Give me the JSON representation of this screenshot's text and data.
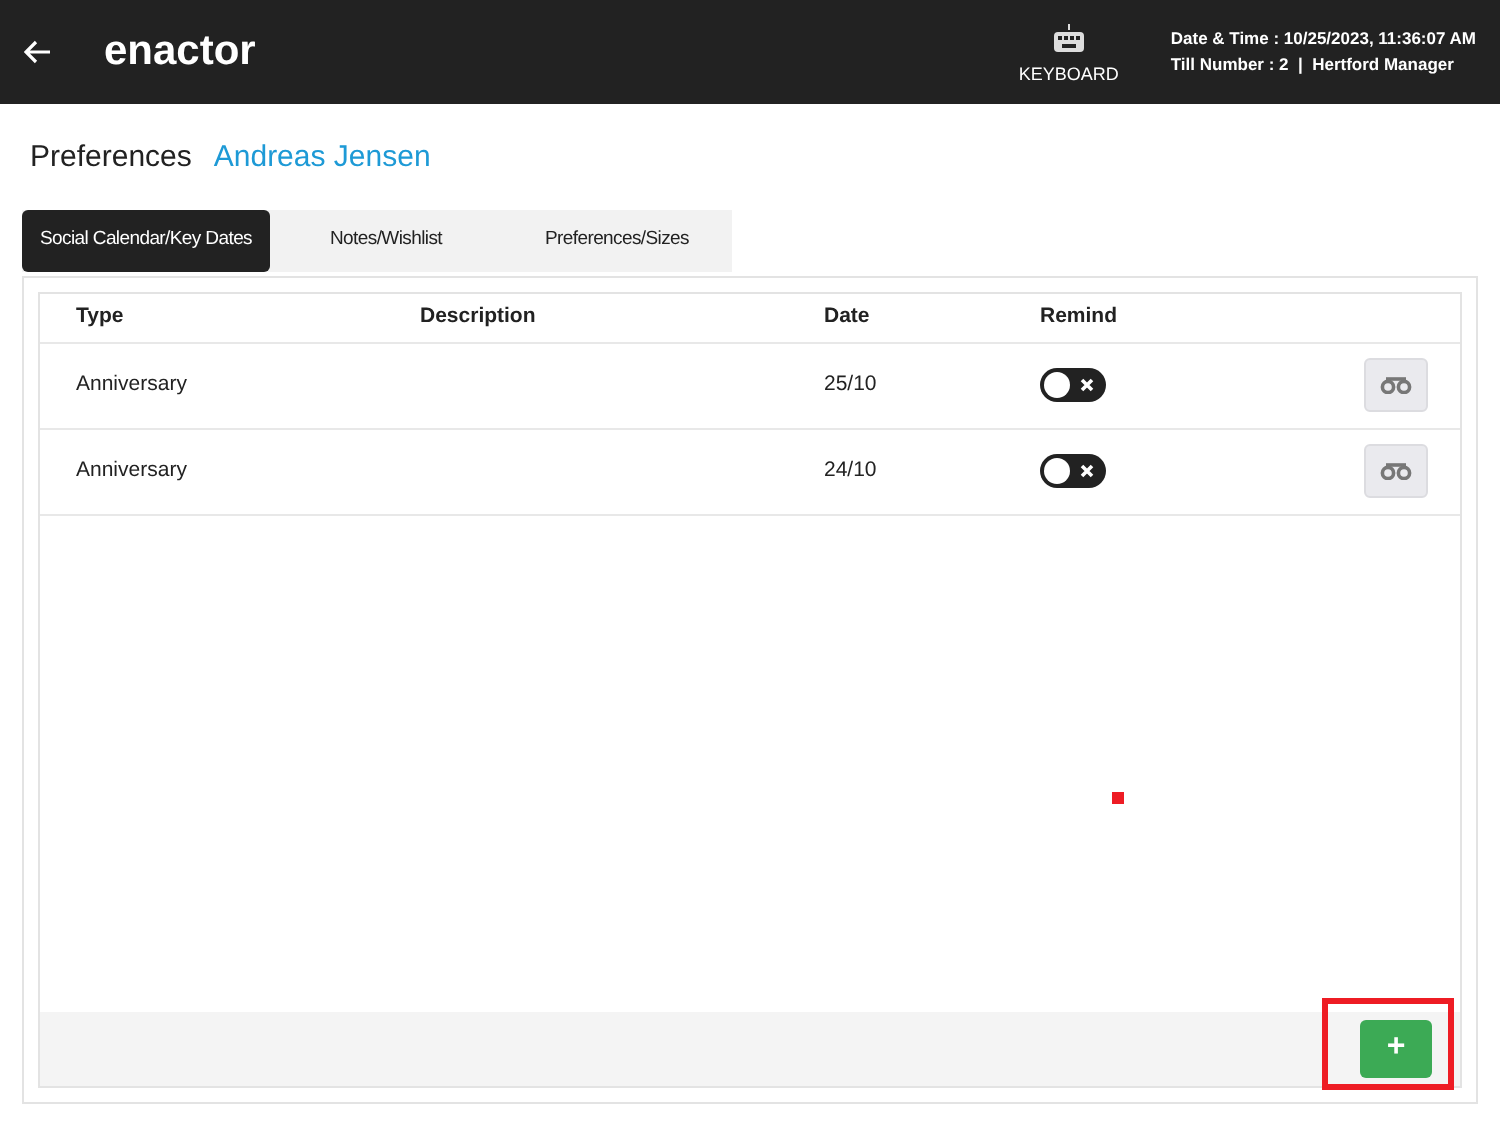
{
  "header": {
    "logo": "enactor",
    "keyboard_label": "KEYBOARD",
    "datetime": "Date & Time : 10/25/2023, 11:36:07 AM",
    "till": "Till Number : 2  |  Hertford Manager"
  },
  "title": {
    "label": "Preferences",
    "customer": "Andreas Jensen"
  },
  "tabs": [
    {
      "label": "Social Calendar/Key Dates",
      "selected": true
    },
    {
      "label": "Notes/Wishlist",
      "selected": false
    },
    {
      "label": "Preferences/Sizes",
      "selected": false
    }
  ],
  "table": {
    "columns": [
      "Type",
      "Description",
      "Date",
      "Remind"
    ],
    "rows": [
      {
        "type": "Anniversary",
        "description": "",
        "date": "25/10",
        "remind_on": false
      },
      {
        "type": "Anniversary",
        "description": "",
        "date": "24/10",
        "remind_on": false
      }
    ]
  },
  "add_button": {
    "label": "+",
    "highlighted": true
  }
}
